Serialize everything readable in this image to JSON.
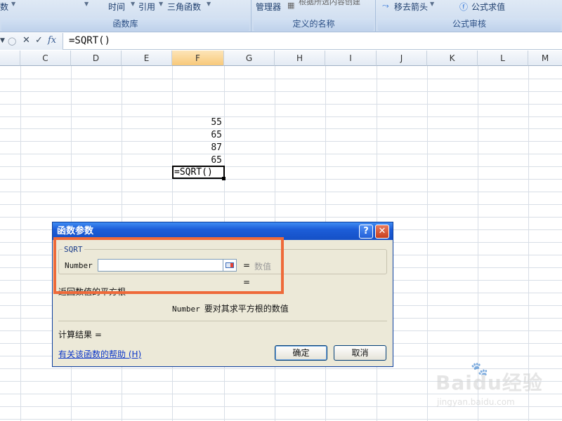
{
  "ribbon": {
    "function_library": {
      "item_partial": "数",
      "time": "时间",
      "reference": "引用",
      "trig": "三角函数",
      "title": "函数库"
    },
    "defined_names": {
      "manager": "管理器",
      "create_from_selection": "根据所选内容创建",
      "title": "定义的名称"
    },
    "formula_auditing": {
      "remove_arrows": "移去箭头",
      "evaluate": "公式求值",
      "title": "公式审核"
    }
  },
  "formula_bar": {
    "formula": "=SQRT()"
  },
  "grid": {
    "columns": [
      "C",
      "D",
      "E",
      "F",
      "G",
      "H",
      "I",
      "J",
      "K",
      "L",
      "M"
    ],
    "active_column": "F",
    "values": [
      "55",
      "65",
      "87",
      "65"
    ],
    "active_cell_text": "=SQRT()"
  },
  "dialog": {
    "title": "函数参数",
    "function_name": "SQRT",
    "arg_label": "Number",
    "arg_value": "",
    "arg_result": "数值",
    "description": "返回数值的平方根",
    "arg_desc_name": "Number",
    "arg_desc_text": "要对其求平方根的数值",
    "result_label": "计算结果 =",
    "help_link": "有关该函数的帮助 (H)",
    "ok": "确定",
    "cancel": "取消",
    "help_btn": "?",
    "close_btn": "✕"
  },
  "watermark": {
    "logo": "Baidu经验",
    "url": "jingyan.baidu.com"
  }
}
